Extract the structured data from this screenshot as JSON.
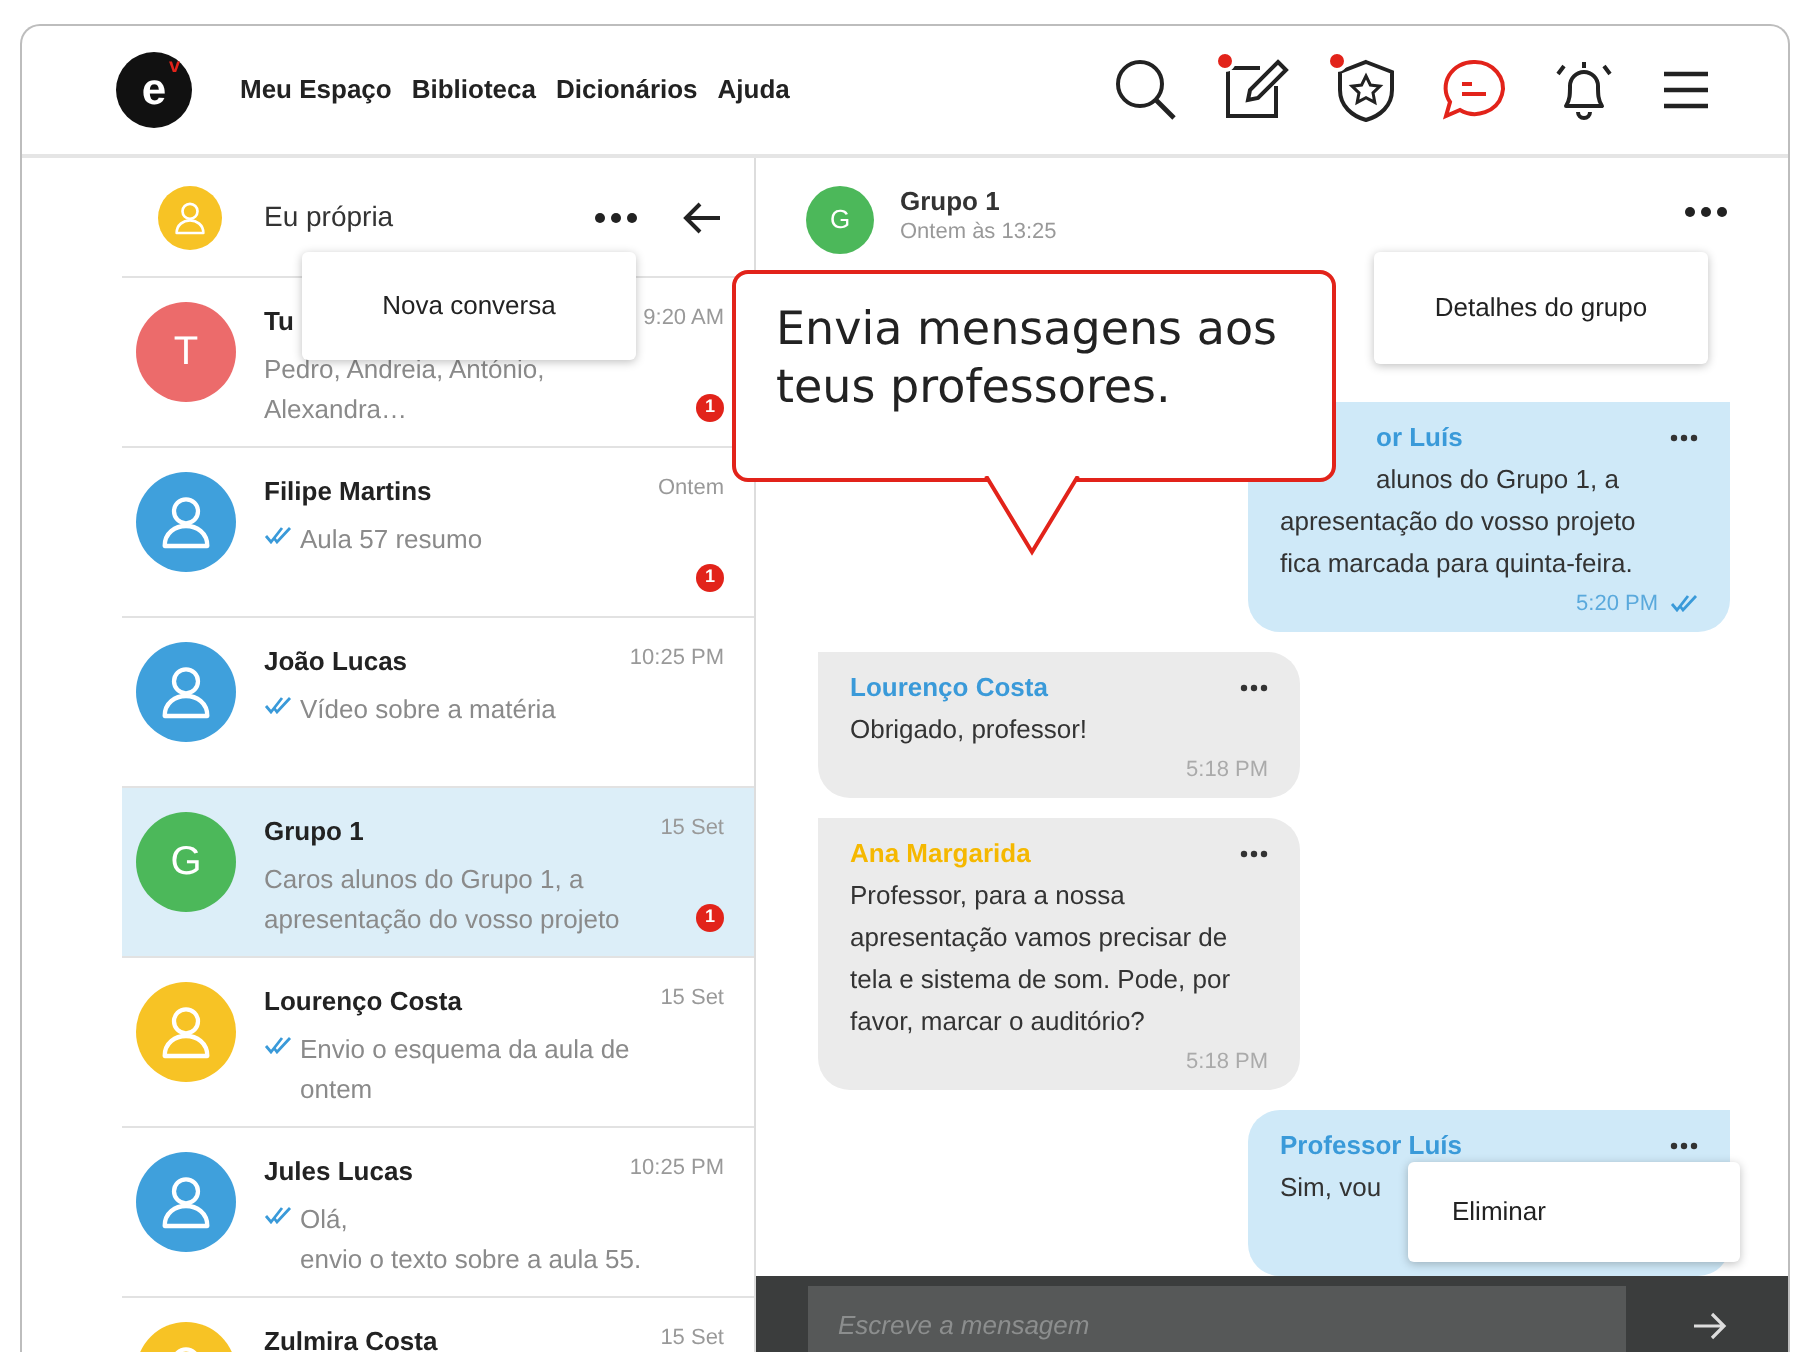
{
  "logo": {
    "letter": "e",
    "mark": "v"
  },
  "nav": [
    "Meu Espaço",
    "Biblioteca",
    "Dicionários",
    "Ajuda"
  ],
  "toolbar": [
    {
      "kind": "search",
      "badge": false,
      "selected": false
    },
    {
      "kind": "edit",
      "badge": true,
      "selected": false
    },
    {
      "kind": "shield",
      "badge": true,
      "selected": false
    },
    {
      "kind": "chat",
      "badge": false,
      "selected": true
    },
    {
      "kind": "bell",
      "badge": false,
      "selected": false
    },
    {
      "kind": "menu",
      "badge": false,
      "selected": false
    }
  ],
  "sidebar": {
    "user": "Eu própria",
    "user_avatar": {
      "color": "#f7c325"
    },
    "menu": [
      "Nova conversa"
    ],
    "conversations": [
      {
        "name": "Tu",
        "time": "9:20 AM",
        "avatar": {
          "kind": "letter",
          "letter": "T",
          "color": "#ec6b6b"
        },
        "ticks": false,
        "preview": [
          "Pedro, Andreia, António,",
          "Alexandra…"
        ],
        "unread": "1",
        "selected": false
      },
      {
        "name": "Filipe Martins",
        "time": "Ontem",
        "avatar": {
          "kind": "person",
          "color": "#3fa0dc"
        },
        "ticks": true,
        "preview": [
          "Aula 57 resumo"
        ],
        "unread": "1",
        "selected": false
      },
      {
        "name": "João Lucas",
        "time": "10:25 PM",
        "avatar": {
          "kind": "person",
          "color": "#3fa0dc"
        },
        "ticks": true,
        "preview": [
          "Vídeo sobre a matéria"
        ],
        "selected": false
      },
      {
        "name": "Grupo 1",
        "time": "15 Set",
        "avatar": {
          "kind": "letter",
          "letter": "G",
          "color": "#4cb85a"
        },
        "ticks": false,
        "preview": [
          "Caros alunos do Grupo 1, a",
          "apresentação do vosso projeto"
        ],
        "unread": "1",
        "selected": true
      },
      {
        "name": "Lourenço Costa",
        "time": "15 Set",
        "avatar": {
          "kind": "person",
          "color": "#f7c325"
        },
        "ticks": true,
        "preview": [
          "Envio o esquema da aula de",
          "ontem"
        ],
        "selected": false
      },
      {
        "name": "Jules Lucas",
        "time": "10:25 PM",
        "avatar": {
          "kind": "person",
          "color": "#3fa0dc"
        },
        "ticks": true,
        "preview": [
          "Olá,",
          "envio o texto sobre a aula 55."
        ],
        "selected": false
      },
      {
        "name": "Zulmira Costa",
        "time": "15 Set",
        "avatar": {
          "kind": "person",
          "color": "#f7c325"
        },
        "selected": false
      }
    ]
  },
  "chat": {
    "title": "Grupo 1",
    "subtitle": "Ontem às 13:25",
    "avatar": {
      "letter": "G",
      "color": "#4cb85a"
    },
    "menu": [
      "Detalhes do grupo"
    ],
    "messages": [
      {
        "kind": "outgoing",
        "covered": true,
        "sender": "or Luís",
        "color": "#3a9ad9",
        "lines": [
          "alunos do Grupo 1, a",
          "apresentação do vosso projeto",
          "fica marcada para quinta-feira."
        ],
        "time": "5:20 PM",
        "ticks": true
      },
      {
        "kind": "incoming",
        "sender": "Lourenço Costa",
        "color": "#3a9ad9",
        "lines": [
          "Obrigado, professor!"
        ],
        "time": "5:18 PM",
        "ticks": false
      },
      {
        "kind": "incoming",
        "sender": "Ana Margarida",
        "color": "#f5b800",
        "lines": [
          "Professor, para a nossa",
          "apresentação vamos precisar de",
          "tela e sistema de som. Pode, por",
          "favor, marcar o auditório?"
        ],
        "time": "5:18 PM",
        "ticks": false
      },
      {
        "kind": "outgoing",
        "covered": false,
        "sender": "Professor Luís",
        "color": "#3a9ad9",
        "lines": [
          "Sim, vou"
        ],
        "menu": [
          "Eliminar"
        ]
      }
    ]
  },
  "callout": {
    "text": "Envia mensagens aos teus professores."
  },
  "composer": {
    "placeholder": "Escreve a mensagem"
  }
}
